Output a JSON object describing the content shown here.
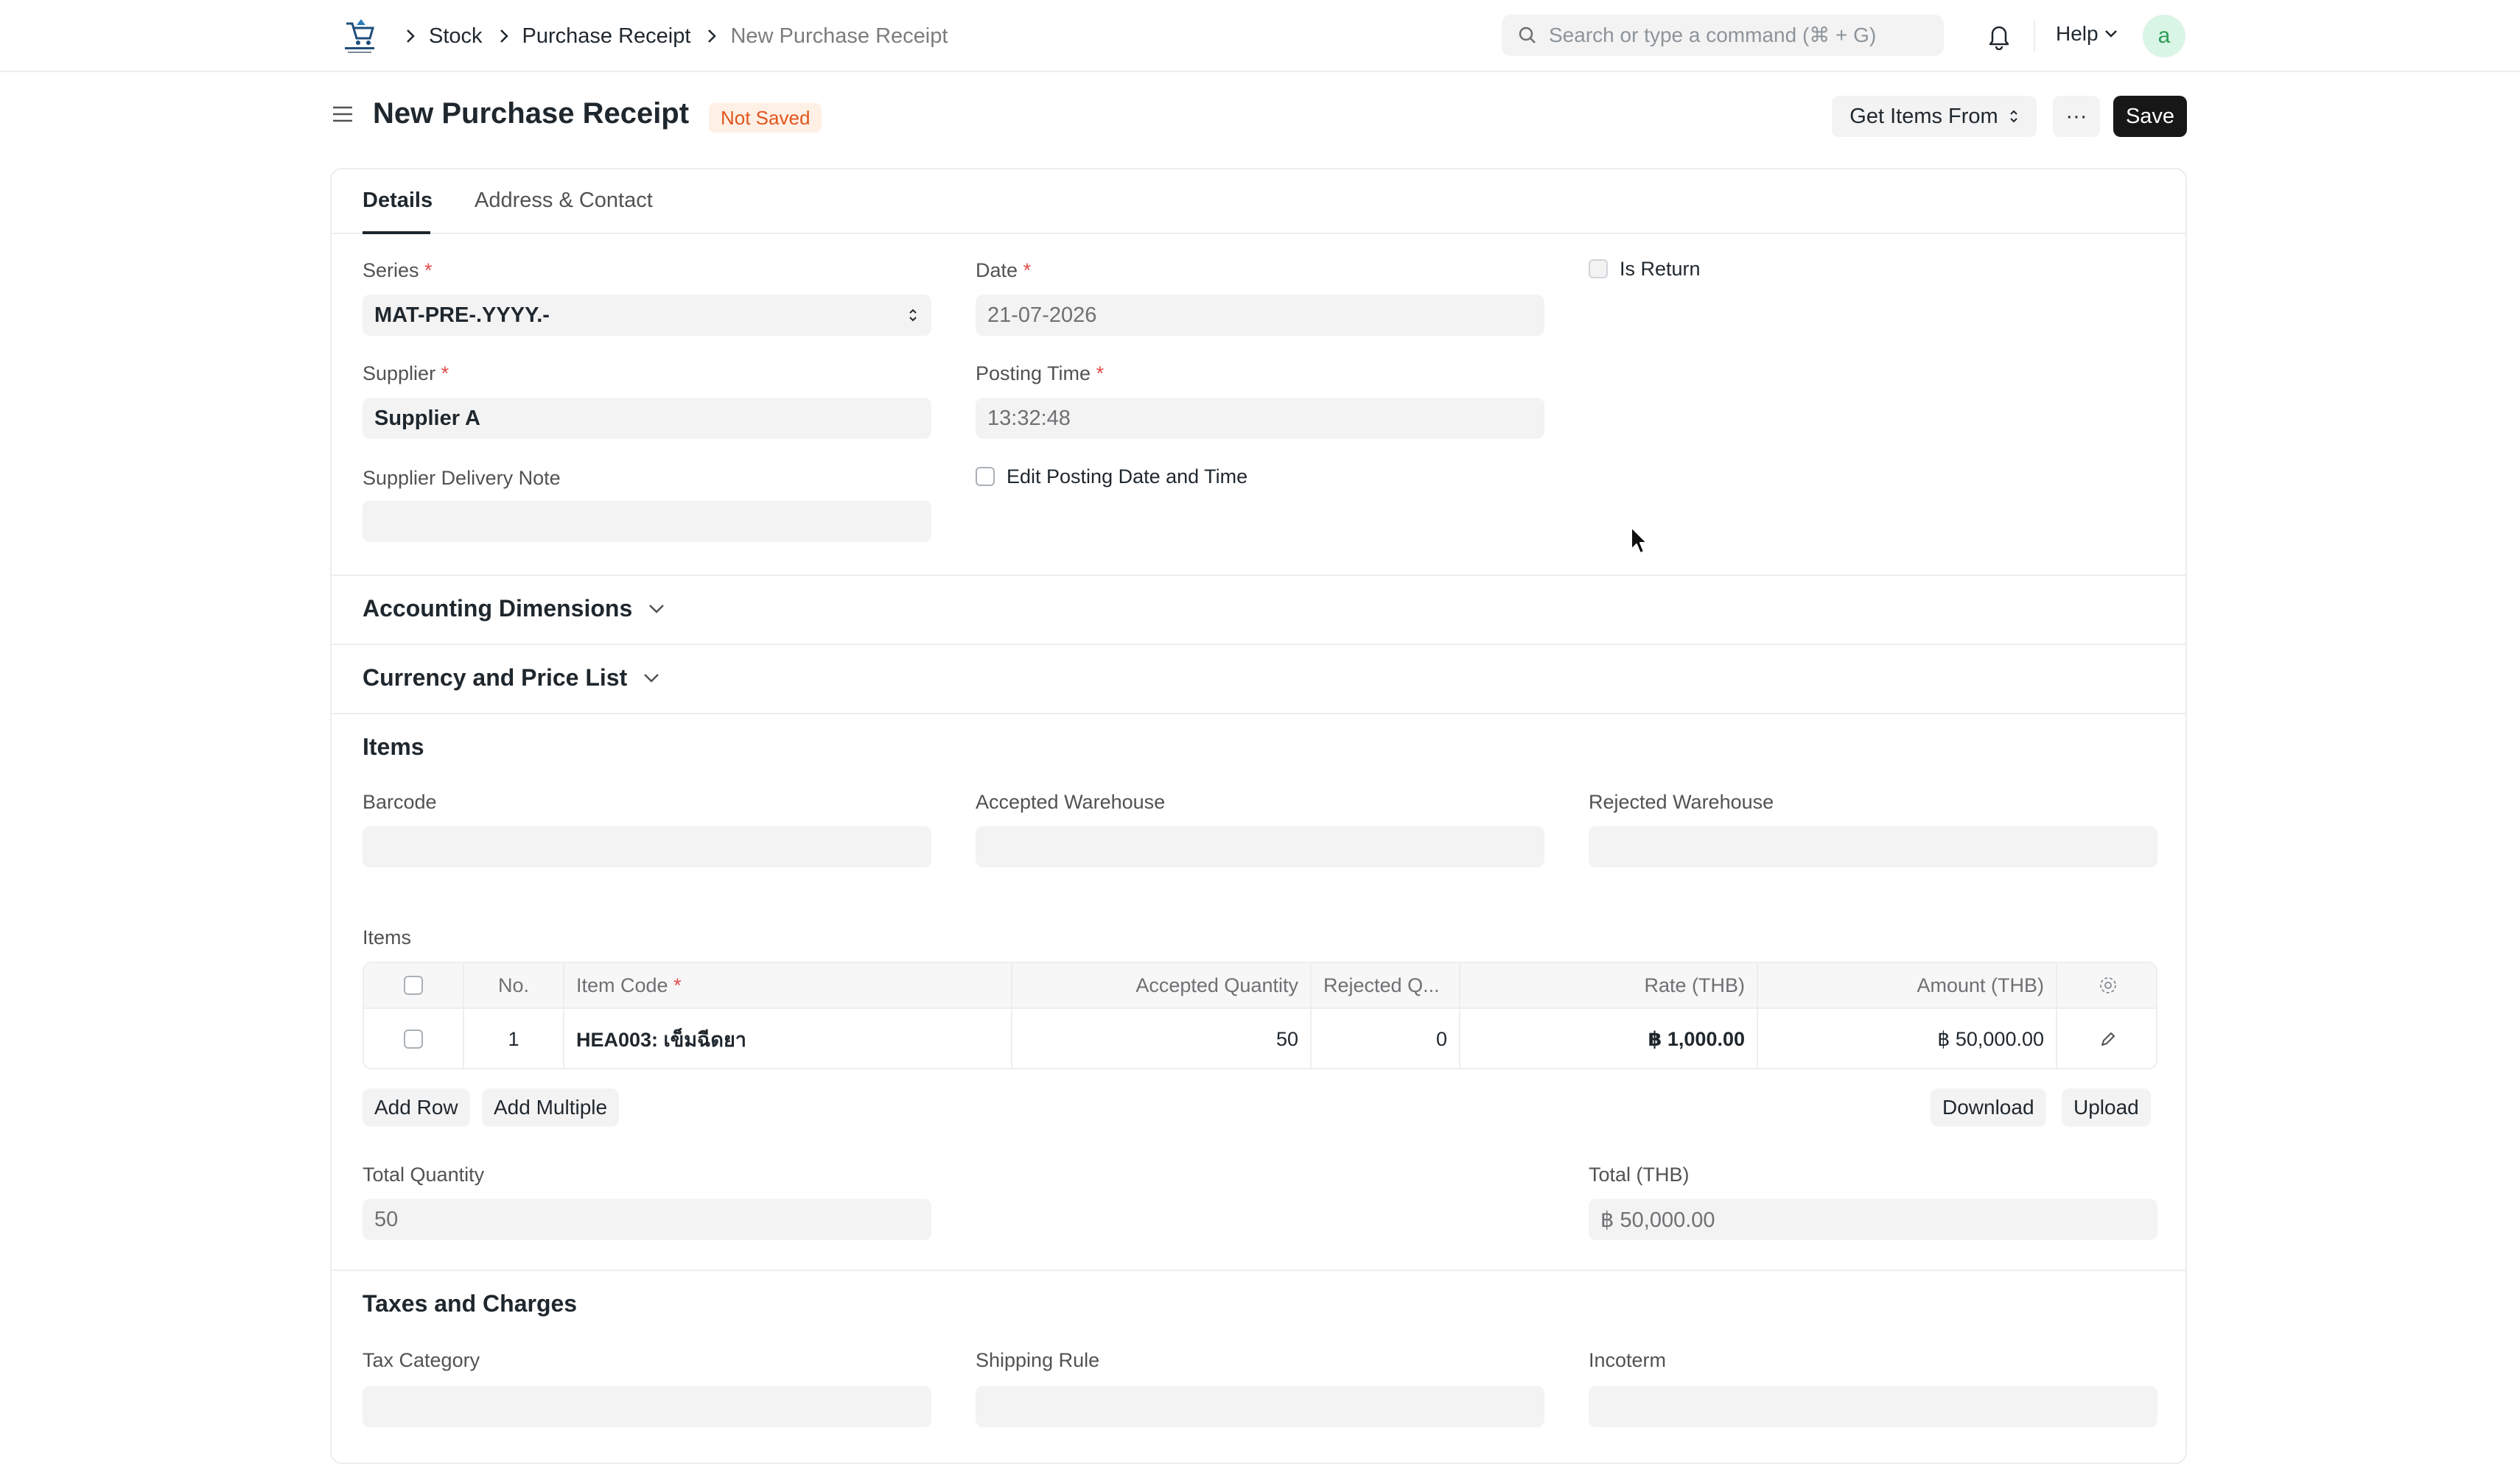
{
  "nav": {
    "breadcrumbs": [
      "Stock",
      "Purchase Receipt",
      "New Purchase Receipt"
    ],
    "search_placeholder": "Search or type a command (⌘ + G)",
    "help_label": "Help",
    "avatar_initial": "a"
  },
  "header": {
    "title": "New Purchase Receipt",
    "status_badge": "Not Saved",
    "get_items_label": "Get Items From",
    "more_label": "···",
    "save_label": "Save"
  },
  "tabs": [
    {
      "label": "Details",
      "active": true
    },
    {
      "label": "Address & Contact",
      "active": false
    }
  ],
  "details": {
    "series_label": "Series",
    "series_value": "MAT-PRE-.YYYY.-",
    "date_label": "Date",
    "date_value": "21-07-2026",
    "is_return_label": "Is Return",
    "supplier_label": "Supplier",
    "supplier_value": "Supplier A",
    "posting_time_label": "Posting Time",
    "posting_time_value": "13:32:48",
    "supplier_delivery_note_label": "Supplier Delivery Note",
    "supplier_delivery_note_value": "",
    "edit_posting_label": "Edit Posting Date and Time"
  },
  "sections": {
    "accounting_dimensions": "Accounting Dimensions",
    "currency_price_list": "Currency and Price List",
    "items": "Items",
    "taxes": "Taxes and Charges"
  },
  "items_section": {
    "barcode_label": "Barcode",
    "accepted_warehouse_label": "Accepted Warehouse",
    "rejected_warehouse_label": "Rejected Warehouse",
    "table_label": "Items",
    "columns": [
      "No.",
      "Item Code",
      "Accepted Quantity",
      "Rejected Q...",
      "Rate (THB)",
      "Amount (THB)"
    ],
    "rows": [
      {
        "no": "1",
        "item_code": "HEA003: เข็มฉีดยา",
        "accepted_qty": "50",
        "rejected_qty": "0",
        "rate": "฿ 1,000.00",
        "amount": "฿ 50,000.00"
      }
    ],
    "add_row_label": "Add Row",
    "add_multiple_label": "Add Multiple",
    "download_label": "Download",
    "upload_label": "Upload",
    "total_qty_label": "Total Quantity",
    "total_qty_value": "50",
    "total_label": "Total (THB)",
    "total_value": "฿ 50,000.00"
  },
  "taxes_section": {
    "tax_category_label": "Tax Category",
    "shipping_rule_label": "Shipping Rule",
    "incoterm_label": "Incoterm"
  },
  "colors": {
    "save_button": "#171717",
    "badge_bg": "#fff0e6",
    "badge_text": "#e0561b",
    "required": "#e24c4c"
  }
}
